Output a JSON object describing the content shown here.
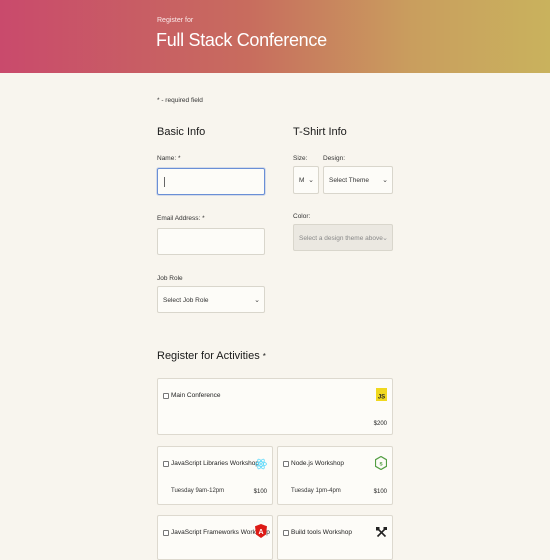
{
  "header": {
    "subtitle": "Register for",
    "title": "Full Stack Conference"
  },
  "required_note": "* - required field",
  "basic_info": {
    "heading": "Basic Info",
    "name_label": "Name: *",
    "name_value": "",
    "email_label": "Email Address: *",
    "email_value": "",
    "job_role_label": "Job Role",
    "job_role_selected": "Select Job Role"
  },
  "tshirt_info": {
    "heading": "T-Shirt Info",
    "size_label": "Size:",
    "size_selected": "M",
    "design_label": "Design:",
    "design_selected": "Select Theme",
    "color_label": "Color:",
    "color_selected": "Select a design theme above"
  },
  "activities": {
    "heading": "Register for Activities",
    "heading_marker": "*",
    "items": [
      {
        "name": "Main Conference",
        "time": "",
        "price": "$200",
        "icon": "javascript-icon"
      },
      {
        "name": "JavaScript Libraries Workshop",
        "time": "Tuesday 9am-12pm",
        "price": "$100",
        "icon": "react-icon"
      },
      {
        "name": "Node.js Workshop",
        "time": "Tuesday 1pm-4pm",
        "price": "$100",
        "icon": "nodejs-icon"
      },
      {
        "name": "JavaScript Frameworks Workshop",
        "time": "",
        "price": "",
        "icon": "angular-icon"
      },
      {
        "name": "Build tools Workshop",
        "time": "",
        "price": "",
        "icon": "tools-icon"
      }
    ]
  },
  "colors": {
    "header_gradient_start": "#c94a6c",
    "header_gradient_end": "#c9b25d",
    "background": "#f8f5ee",
    "focus_border": "#6a8fd6"
  }
}
